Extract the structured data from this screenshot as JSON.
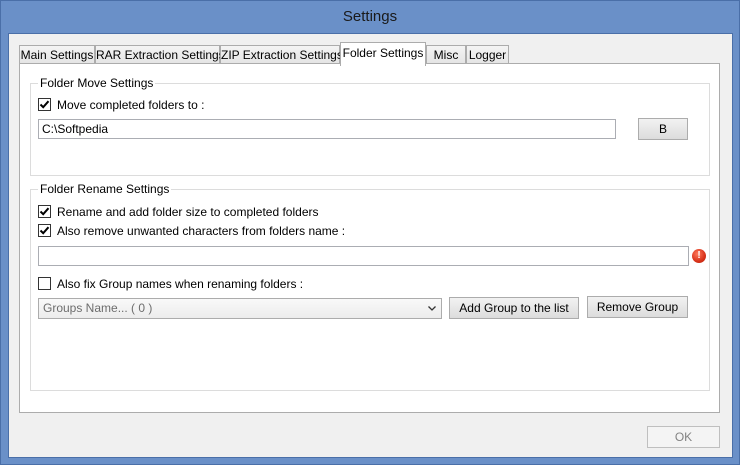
{
  "window": {
    "title": "Settings"
  },
  "tabs": [
    {
      "label": "Main Settings"
    },
    {
      "label": "RAR Extraction Settings"
    },
    {
      "label": "ZIP Extraction Settings"
    },
    {
      "label": "Folder Settings"
    },
    {
      "label": "Misc"
    },
    {
      "label": "Logger"
    }
  ],
  "active_tab": "Folder Settings",
  "folder_move": {
    "group_title": "Folder Move Settings",
    "move_checkbox_label": "Move completed folders to :",
    "move_checked": true,
    "path_value": "C:\\Softpedia",
    "browse_label": "B"
  },
  "folder_rename": {
    "group_title": "Folder Rename Settings",
    "rename_checkbox_label": "Rename and add folder size to completed folders",
    "rename_checked": true,
    "remove_chars_label": "Also remove unwanted characters from folders name :",
    "remove_chars_checked": true,
    "chars_value": "",
    "fix_groups_label": "Also fix Group names when renaming folders :",
    "fix_groups_checked": false,
    "groups_select_value": "Groups Name... ( 0 )",
    "add_group_label": "Add Group to the list",
    "remove_group_label": "Remove Group",
    "error_icon": "error-icon"
  },
  "footer": {
    "ok_label": "OK"
  }
}
